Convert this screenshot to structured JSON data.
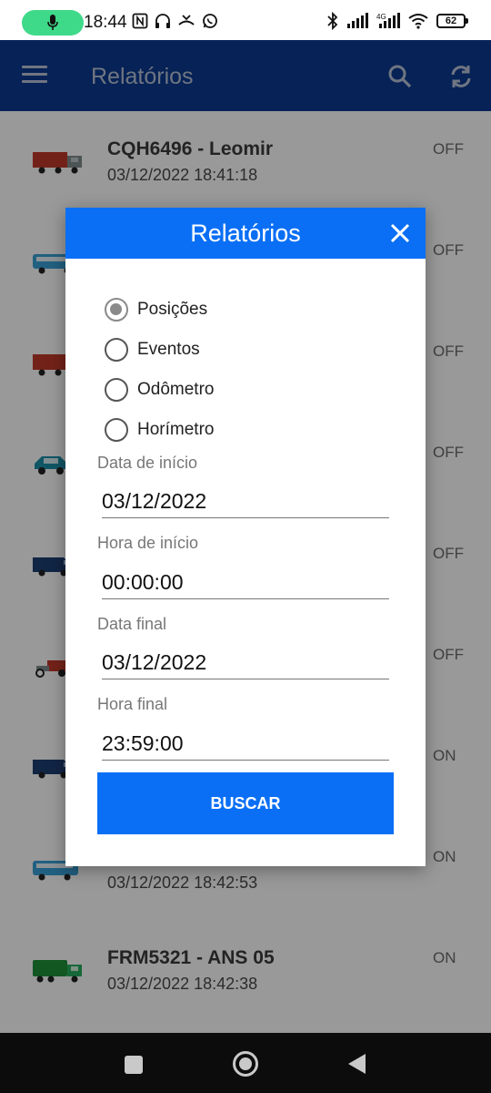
{
  "status_bar": {
    "time": "18:44",
    "battery": "62",
    "icons_left": [
      "mic-icon",
      "nfc-icon",
      "headset-icon",
      "missed-call-icon",
      "whatsapp-icon"
    ],
    "icons_right": [
      "bluetooth-icon",
      "signal-icon",
      "4g-signal-icon",
      "wifi-icon",
      "battery-icon"
    ]
  },
  "app_bar": {
    "title": "Relatórios",
    "icons": [
      "menu-icon",
      "search-icon",
      "sync-icon"
    ]
  },
  "vehicles": [
    {
      "plate": "CQH6496 - Leomir",
      "timestamp": "03/12/2022 18:41:18",
      "state": "OFF",
      "icon": "truck-red-icon"
    },
    {
      "plate": "",
      "timestamp": "",
      "state": "OFF",
      "icon": "bus-blue-icon"
    },
    {
      "plate": "",
      "timestamp": "",
      "state": "OFF",
      "icon": "truck-red-icon"
    },
    {
      "plate": "",
      "timestamp": "",
      "state": "OFF",
      "icon": "car-teal-icon"
    },
    {
      "plate": "",
      "timestamp": "",
      "state": "OFF",
      "icon": "van-blue-icon"
    },
    {
      "plate": "",
      "timestamp": "",
      "state": "OFF",
      "icon": "tow-truck-icon"
    },
    {
      "plate": "",
      "timestamp": "",
      "state": "ON",
      "icon": "van-blue-icon"
    },
    {
      "plate": "",
      "timestamp": "03/12/2022 18:42:53",
      "state": "ON",
      "icon": "bus-blue-icon"
    },
    {
      "plate": "FRM5321 - ANS 05",
      "timestamp": "03/12/2022 18:42:38",
      "state": "ON",
      "icon": "garbage-truck-icon"
    }
  ],
  "dialog": {
    "title": "Relatórios",
    "options": [
      "Posições",
      "Eventos",
      "Odômetro",
      "Horímetro"
    ],
    "selected_option": "Posições",
    "fields": [
      {
        "label": "Data de início",
        "value": "03/12/2022"
      },
      {
        "label": "Hora de início",
        "value": "00:00:00"
      },
      {
        "label": "Data final",
        "value": "03/12/2022"
      },
      {
        "label": "Hora final",
        "value": "23:59:00"
      }
    ],
    "button_label": "BUSCAR"
  },
  "colors": {
    "app_bar": "#0a3a8f",
    "dialog_header": "#0a6ff5",
    "button": "#0a6ff5",
    "mic_pill": "#3fd98a"
  }
}
